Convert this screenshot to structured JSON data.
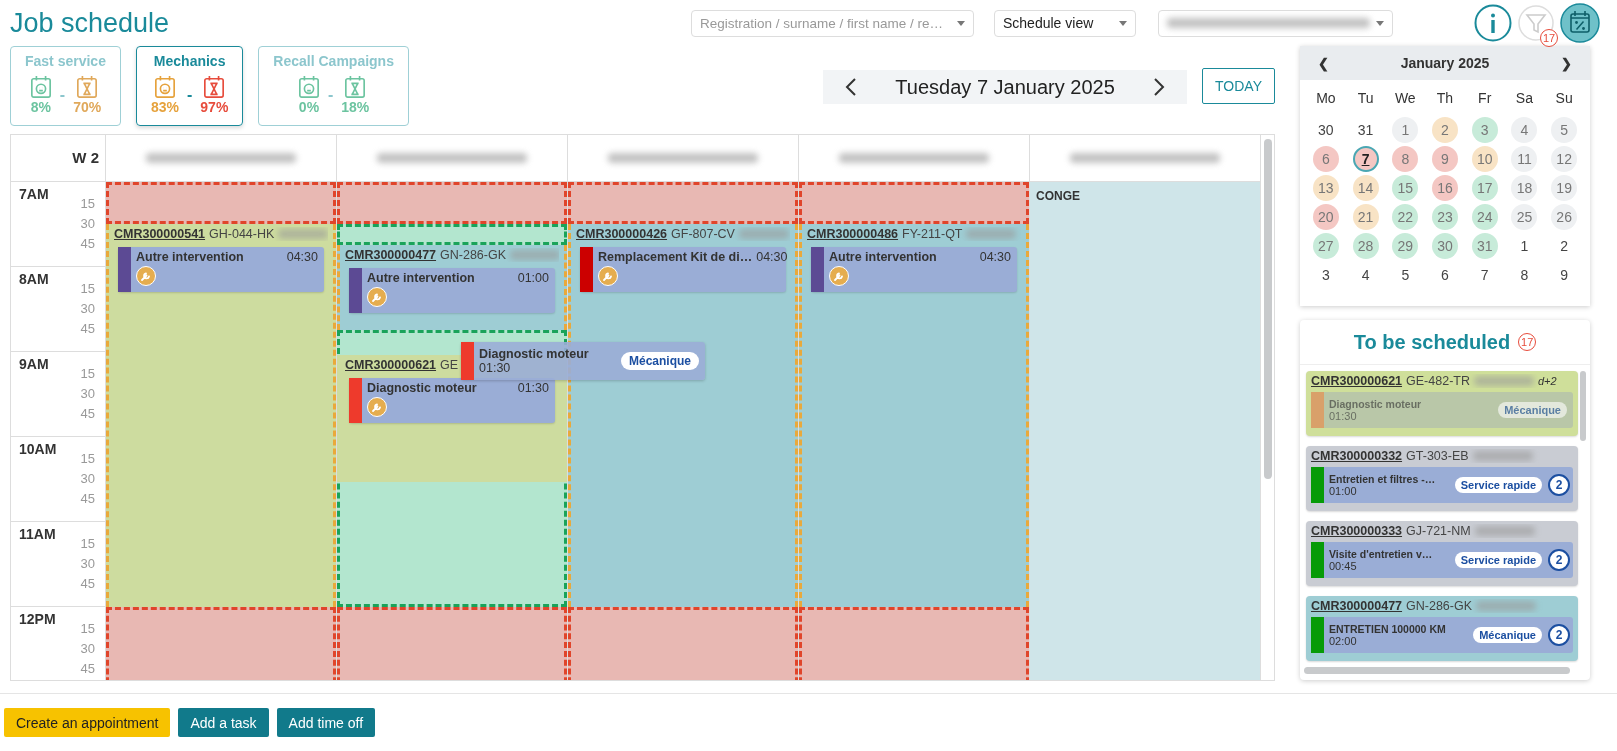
{
  "title": "Job schedule",
  "filters": {
    "search_placeholder": "Registration / surname / first name / re…",
    "view": "Schedule view",
    "filter_count": "17"
  },
  "stats": [
    {
      "label": "Fast service",
      "selected": false,
      "separator": "-",
      "metrics": [
        {
          "value": "8%",
          "kind": "car",
          "color": "#6cc4a0"
        },
        {
          "value": "70%",
          "kind": "hourglass",
          "color": "#e0a85a"
        }
      ]
    },
    {
      "label": "Mechanics",
      "selected": true,
      "separator": "-",
      "metrics": [
        {
          "value": "83%",
          "kind": "car",
          "color": "#e6a23c"
        },
        {
          "value": "97%",
          "kind": "hourglass",
          "color": "#e74c3c"
        }
      ]
    },
    {
      "label": "Recall Campaigns",
      "selected": false,
      "separator": "-",
      "metrics": [
        {
          "value": "0%",
          "kind": "car",
          "color": "#6cc4a0"
        },
        {
          "value": "18%",
          "kind": "hourglass",
          "color": "#6cc4a0"
        }
      ]
    }
  ],
  "date_nav": {
    "date": "Tuesday 7 January 2025",
    "today": "TODAY"
  },
  "schedule": {
    "week": "W 2",
    "hours": [
      {
        "label": "7AM",
        "quarters": [
          "15",
          "30",
          "45"
        ]
      },
      {
        "label": "8AM",
        "quarters": [
          "15",
          "30",
          "45"
        ]
      },
      {
        "label": "9AM",
        "quarters": [
          "15",
          "30",
          "45"
        ]
      },
      {
        "label": "10AM",
        "quarters": [
          "15",
          "30",
          "45"
        ]
      },
      {
        "label": "11AM",
        "quarters": [
          "15",
          "30",
          "45"
        ]
      },
      {
        "label": "12PM",
        "quarters": [
          "15",
          "30",
          "45"
        ]
      }
    ],
    "columns": [
      {
        "events": [
          {
            "kind": "unavailable"
          },
          {
            "kind": "appointment",
            "order": "CMR300000541",
            "plate": "GH-044-HK",
            "color": "#cddc9f",
            "tasks": [
              {
                "title": "Autre intervention",
                "duration": "04:30",
                "color": "#5c4a94"
              }
            ]
          },
          {
            "kind": "unavailable"
          }
        ]
      },
      {
        "events": [
          {
            "kind": "unavailable"
          },
          {
            "kind": "free"
          },
          {
            "kind": "appointment",
            "order": "CMR300000477",
            "plate": "GN-286-GK",
            "color": "#9ecdd4",
            "tasks": [
              {
                "title": "Autre intervention",
                "duration": "01:00",
                "color": "#5c4a94"
              }
            ]
          },
          {
            "kind": "zone",
            "children": [
              {
                "kind": "appointment",
                "order": "CMR300000621",
                "plate": "GE",
                "color": "#cddc9f",
                "tasks": [
                  {
                    "title": "Diagnostic moteur",
                    "duration": "01:30",
                    "color": "#ee3a2c"
                  }
                ]
              }
            ]
          },
          {
            "kind": "unavailable"
          }
        ]
      },
      {
        "events": [
          {
            "kind": "unavailable"
          },
          {
            "kind": "appointment",
            "order": "CMR300000426",
            "plate": "GF-807-CV",
            "color": "#9ecdd4",
            "tasks": [
              {
                "title": "Remplacement Kit de di…",
                "duration": "04:30",
                "color": "#cc0000"
              }
            ]
          },
          {
            "kind": "unavailable"
          }
        ]
      },
      {
        "events": [
          {
            "kind": "unavailable"
          },
          {
            "kind": "appointment",
            "order": "CMR300000486",
            "plate": "FY-211-QT",
            "color": "#9ecdd4",
            "tasks": [
              {
                "title": "Autre intervention",
                "duration": "04:30",
                "color": "#5c4a94"
              }
            ]
          },
          {
            "kind": "unavailable"
          }
        ]
      },
      {
        "events": [
          {
            "kind": "leave",
            "label": "CONGE"
          }
        ]
      }
    ]
  },
  "drag_preview": {
    "title": "Diagnostic moteur",
    "duration": "01:30",
    "tag": "Mécanique",
    "color": "#ee3a2c"
  },
  "calendar": {
    "month": "January 2025",
    "prev": "❮",
    "next": "❯",
    "weekdays": [
      "Mo",
      "Tu",
      "We",
      "Th",
      "Fr",
      "Sa",
      "Su"
    ],
    "days": [
      {
        "label": "30",
        "other_month": true,
        "selected": false
      },
      {
        "label": "31",
        "other_month": true,
        "selected": false
      },
      {
        "label": "1",
        "color": "#eef0f2",
        "selected": false
      },
      {
        "label": "2",
        "color": "#f8e3c5",
        "selected": false
      },
      {
        "label": "3",
        "color": "#c7ebd9",
        "selected": false
      },
      {
        "label": "4",
        "color": "#eef0f2",
        "selected": false
      },
      {
        "label": "5",
        "color": "#eef0f2",
        "selected": false
      },
      {
        "label": "6",
        "color": "#f4c7c3",
        "selected": false
      },
      {
        "label": "7",
        "color": "#f4c7c3",
        "selected": true
      },
      {
        "label": "8",
        "color": "#f4c7c3",
        "selected": false
      },
      {
        "label": "9",
        "color": "#f4c7c3",
        "selected": false
      },
      {
        "label": "10",
        "color": "#f8e3c5",
        "selected": false
      },
      {
        "label": "11",
        "color": "#eef0f2",
        "selected": false
      },
      {
        "label": "12",
        "color": "#eef0f2",
        "selected": false
      },
      {
        "label": "13",
        "color": "#f8e3c5",
        "selected": false
      },
      {
        "label": "14",
        "color": "#f8e3c5",
        "selected": false
      },
      {
        "label": "15",
        "color": "#c7ebd9",
        "selected": false
      },
      {
        "label": "16",
        "color": "#f4c7c3",
        "selected": false
      },
      {
        "label": "17",
        "color": "#c7ebd9",
        "selected": false
      },
      {
        "label": "18",
        "color": "#eef0f2",
        "selected": false
      },
      {
        "label": "19",
        "color": "#eef0f2",
        "selected": false
      },
      {
        "label": "20",
        "color": "#f4c7c3",
        "selected": false
      },
      {
        "label": "21",
        "color": "#f8e3c5",
        "selected": false
      },
      {
        "label": "22",
        "color": "#c7ebd9",
        "selected": false
      },
      {
        "label": "23",
        "color": "#c7ebd9",
        "selected": false
      },
      {
        "label": "24",
        "color": "#c7ebd9",
        "selected": false
      },
      {
        "label": "25",
        "color": "#eef0f2",
        "selected": false
      },
      {
        "label": "26",
        "color": "#eef0f2",
        "selected": false
      },
      {
        "label": "27",
        "color": "#c7ebd9",
        "selected": false
      },
      {
        "label": "28",
        "color": "#c7ebd9",
        "selected": false
      },
      {
        "label": "29",
        "color": "#c7ebd9",
        "selected": false
      },
      {
        "label": "30",
        "color": "#c7ebd9",
        "selected": false
      },
      {
        "label": "31",
        "color": "#c7ebd9",
        "selected": false
      },
      {
        "label": "1",
        "other_month": true,
        "selected": false
      },
      {
        "label": "2",
        "other_month": true,
        "selected": false
      },
      {
        "label": "3",
        "other_month": true,
        "selected": false
      },
      {
        "label": "4",
        "other_month": true,
        "selected": false
      },
      {
        "label": "5",
        "other_month": true,
        "selected": false
      },
      {
        "label": "6",
        "other_month": true,
        "selected": false
      },
      {
        "label": "7",
        "other_month": true,
        "selected": false
      },
      {
        "label": "8",
        "other_month": true,
        "selected": false
      },
      {
        "label": "9",
        "other_month": true,
        "selected": false
      }
    ]
  },
  "to_schedule": {
    "title": "To be scheduled",
    "count": "17",
    "items": [
      {
        "order": "CMR300000621",
        "plate": "GE-482-TR",
        "due": "d+2",
        "color": "#cfdf9a",
        "disabled": true,
        "task": {
          "title": "Diagnostic moteur",
          "duration": "01:30",
          "tag": "Mécanique",
          "color": "#d9a06a"
        }
      },
      {
        "order": "CMR300000332",
        "plate": "GT-303-EB",
        "color": "#c9ccd3",
        "disabled": false,
        "task": {
          "title": "Entretien et filtres -…",
          "duration": "01:00",
          "tag": "Service rapide",
          "count": "2",
          "color": "#079b07"
        }
      },
      {
        "order": "CMR300000333",
        "plate": "GJ-721-NM",
        "color": "#c9ccd3",
        "disabled": false,
        "task": {
          "title": "Visite d'entretien v…",
          "duration": "00:45",
          "tag": "Service rapide",
          "count": "2",
          "color": "#079b07"
        }
      },
      {
        "order": "CMR300000477",
        "plate": "GN-286-GK",
        "color": "#9ecdd4",
        "disabled": false,
        "task": {
          "title": "ENTRETIEN 100000 KM",
          "duration": "02:00",
          "tag": "Mécanique",
          "count": "2",
          "color": "#079b07"
        }
      }
    ]
  },
  "actions": [
    "Create an appointment",
    "Add a task",
    "Add time off"
  ]
}
